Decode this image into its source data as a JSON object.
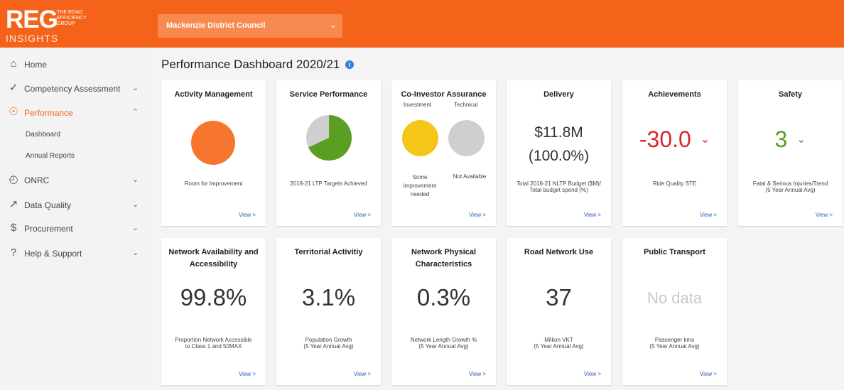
{
  "logo": {
    "wordmark": "REG",
    "tagline_line1": "THE ROAD",
    "tagline_line2": "EFFICIENCY",
    "tagline_line3": "GROUP",
    "subtitle": "INSIGHTS"
  },
  "council_select": {
    "value": "Mackenzie District Council"
  },
  "sidebar": {
    "home": "Home",
    "competency": "Competency Assessment",
    "performance": "Performance",
    "dashboard": "Dashboard",
    "annual_reports": "Annual Reports",
    "onrc": "ONRC",
    "data_quality": "Data Quality",
    "procurement": "Procurement",
    "help": "Help & Support"
  },
  "page": {
    "title": "Performance Dashboard 2020/21"
  },
  "view_label": "View >",
  "cards": {
    "activity": {
      "title": "Activity Management",
      "desc": "Room for Improvement",
      "color": "#f5762c"
    },
    "service": {
      "title": "Service Performance",
      "desc": "2018-21 LTP Targets Achieved",
      "achieved_fraction": 0.68
    },
    "coinvestor": {
      "title": "Co-Investor Assurance",
      "investment_label": "Investment",
      "technical_label": "Technical",
      "investment_desc": "Some improvement needed",
      "technical_desc": "Not Available"
    },
    "delivery": {
      "title": "Delivery",
      "amount": "$11.8M",
      "percent": "(100.0%)",
      "desc_line1": "Total 2018-21 NLTP Budget ($M)/",
      "desc_line2": "Total budget spend (%)"
    },
    "achievements": {
      "title": "Achievements",
      "value": "-30.0",
      "desc": "Ride Quality STE"
    },
    "safety": {
      "title": "Safety",
      "value": "3",
      "desc_line1": "Fatal & Serious Injuries/Trend",
      "desc_line2": "(5 Year Annual Avg)"
    },
    "network_avail": {
      "title_line1": "Network Availability and",
      "title_line2": "Accessibility",
      "value": "99.8%",
      "desc_line1": "Proportion Network Accessible",
      "desc_line2": "to Class 1 and 50MAX"
    },
    "territorial": {
      "title": "Territorial Activitiy",
      "value": "3.1%",
      "desc_line1": "Population Growth",
      "desc_line2": "(5 Year Annual Avg)"
    },
    "physical": {
      "title_line1": "Network Physical",
      "title_line2": "Characteristics",
      "value": "0.3%",
      "desc_line1": "Network Length Growth %",
      "desc_line2": "(5 Year Annual Avg)"
    },
    "road_use": {
      "title": "Road Network Use",
      "value": "37",
      "desc_line1": "Million VKT",
      "desc_line2": "(5 Year Annual Avg)"
    },
    "transport": {
      "title": "Public Transport",
      "value": "No data",
      "desc_line1": "Passenger kms",
      "desc_line2": "(5 Year Annual Avg)"
    }
  },
  "colors": {
    "brand": "#f5631b",
    "red": "#d9262b",
    "green": "#5a9e22",
    "yellow": "#f5c518",
    "grey": "#cfcfcf",
    "link": "#2a5bb5"
  }
}
